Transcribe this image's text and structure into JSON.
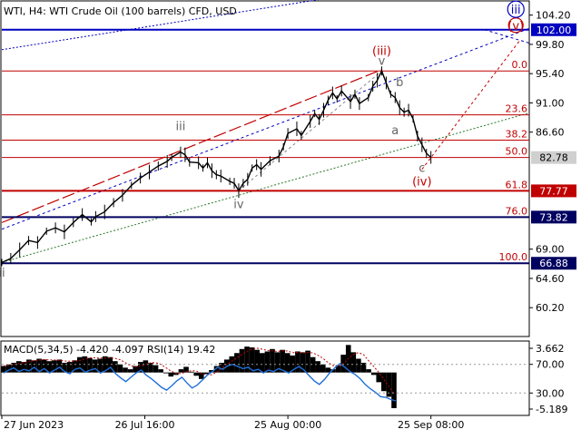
{
  "header": {
    "title": "WTI, H4:  WTI Crude Oil (100 barrels) CFD, USD",
    "indicator_label": "MACD(5,34,5) -4.420 -4.097 RSI(14) 19.42"
  },
  "colors": {
    "price_line": "#000000",
    "fib_line": "#c00000",
    "key_level": "#c00000",
    "level_blue": "#0000c0",
    "level_navy": "#000060",
    "wave_red": "#c00000",
    "wave_blue": "#0000c0",
    "wave_grey": "#666666",
    "macd_hist": "#000000",
    "rsi_line": "#1e6fd9",
    "signal_red": "#c00000"
  },
  "chart_data": {
    "type": "line",
    "instrument": "WTI, H4",
    "x_ticks": [
      "27 Jun 2023",
      "26 Jul 16:00",
      "25 Aug 00:00",
      "25 Sep 08:00"
    ],
    "price_axis": {
      "ylim": [
        56.0,
        106.2
      ],
      "ticks": [
        104.2,
        99.8,
        95.4,
        91.0,
        86.6,
        82.78,
        77.77,
        73.82,
        69.0,
        64.6,
        60.2,
        66.88,
        102.0
      ]
    },
    "tick_labels": [
      "104.20",
      "99.80",
      "95.40",
      "91.00",
      "86.60",
      "69.00",
      "64.60",
      "60.20"
    ],
    "price_series": [
      [
        0,
        67.0
      ],
      [
        2,
        67.6
      ],
      [
        4,
        68.9
      ],
      [
        6,
        70.3
      ],
      [
        8,
        70.0
      ],
      [
        10,
        71.7
      ],
      [
        12,
        72.2
      ],
      [
        14,
        71.6
      ],
      [
        16,
        73.0
      ],
      [
        18,
        74.2
      ],
      [
        20,
        73.1
      ],
      [
        21,
        73.9
      ],
      [
        23,
        74.6
      ],
      [
        25,
        76.0
      ],
      [
        27,
        77.1
      ],
      [
        29,
        78.6
      ],
      [
        31,
        79.7
      ],
      [
        33,
        80.6
      ],
      [
        35,
        81.5
      ],
      [
        37,
        82.2
      ],
      [
        38,
        82.8
      ],
      [
        40,
        83.6
      ],
      [
        41,
        83.2
      ],
      [
        42,
        82.1
      ],
      [
        44,
        82.0
      ],
      [
        45,
        81.2
      ],
      [
        46,
        82.0
      ],
      [
        47,
        80.8
      ],
      [
        48,
        80.2
      ],
      [
        49,
        80.0
      ],
      [
        51,
        79.2
      ],
      [
        52,
        78.9
      ],
      [
        53,
        77.8
      ],
      [
        54,
        78.9
      ],
      [
        55,
        79.5
      ],
      [
        56,
        81.2
      ],
      [
        57,
        81.7
      ],
      [
        58,
        81.0
      ],
      [
        60,
        82.3
      ],
      [
        62,
        83.0
      ],
      [
        63,
        84.4
      ],
      [
        64,
        86.4
      ],
      [
        66,
        87.1
      ],
      [
        67,
        86.1
      ],
      [
        69,
        88.2
      ],
      [
        70,
        89.4
      ],
      [
        71,
        88.5
      ],
      [
        72,
        89.9
      ],
      [
        73,
        91.4
      ],
      [
        74,
        92.5
      ],
      [
        75,
        91.6
      ],
      [
        76,
        92.8
      ],
      [
        78,
        91.2
      ],
      [
        79,
        92.3
      ],
      [
        80,
        90.9
      ],
      [
        82,
        91.8
      ],
      [
        83,
        93.5
      ],
      [
        84,
        94.4
      ],
      [
        85,
        95.8
      ],
      [
        86,
        94.0
      ],
      [
        87,
        92.3
      ],
      [
        88,
        91.8
      ],
      [
        89,
        90.3
      ],
      [
        90,
        89.6
      ],
      [
        91,
        89.9
      ],
      [
        92,
        88.6
      ],
      [
        93,
        86.0
      ],
      [
        94,
        84.7
      ],
      [
        95,
        83.4
      ],
      [
        96,
        82.8
      ]
    ],
    "horizontal_levels": [
      {
        "label": "0.0",
        "price": 95.8,
        "kind": "fib"
      },
      {
        "label": "23.6",
        "price": 89.2,
        "kind": "fib"
      },
      {
        "label": "38.2",
        "price": 85.4,
        "kind": "fib"
      },
      {
        "label": "50.0",
        "price": 82.78,
        "kind": "fib"
      },
      {
        "label": "61.8",
        "price": 77.77,
        "kind": "key"
      },
      {
        "label": "76.0",
        "price": 73.82,
        "kind": "navy"
      },
      {
        "label": "100.0",
        "price": 66.88,
        "kind": "navy"
      },
      {
        "label": "",
        "price": 102.0,
        "kind": "blue"
      }
    ],
    "axis_badges": [
      {
        "text": "102.00",
        "price": 102.0,
        "color": "#0000c0"
      },
      {
        "text": "82.78",
        "price": 82.78,
        "color": "#d0d0d0"
      },
      {
        "text": "77.77",
        "price": 77.77,
        "color": "#c00000"
      },
      {
        "text": "73.82",
        "price": 73.82,
        "color": "#000060"
      },
      {
        "text": "66.88",
        "price": 66.88,
        "color": "#000060"
      }
    ],
    "wave_labels": [
      {
        "text": "ii",
        "x": 0,
        "price": 64.9,
        "color": "#666666"
      },
      {
        "text": "iii",
        "x": 40,
        "price": 86.9,
        "color": "#666666"
      },
      {
        "text": "iv",
        "x": 53,
        "price": 75.2,
        "color": "#666666"
      },
      {
        "text": "(iii)",
        "x": 85,
        "price": 98.2,
        "color": "#c00000"
      },
      {
        "text": "v",
        "x": 85,
        "price": 96.7,
        "color": "#666666"
      },
      {
        "text": "b",
        "x": 89,
        "price": 93.5,
        "color": "#666666"
      },
      {
        "text": "a",
        "x": 88,
        "price": 86.3,
        "color": "#666666"
      },
      {
        "text": "c",
        "x": 94,
        "price": 80.6,
        "color": "#666666"
      },
      {
        "text": "(iv)",
        "x": 94,
        "price": 78.6,
        "color": "#c00000"
      },
      {
        "text": "(v)",
        "x": 115,
        "price": 102.0,
        "color": "#c00000"
      },
      {
        "text": "iii",
        "x": 115,
        "price": 104.4,
        "color": "#0000c0"
      }
    ],
    "forecast": [
      [
        94,
        81.0
      ],
      [
        116,
        100.5
      ]
    ],
    "indicator": {
      "name": "MACD(5,34,5) RSI(14)",
      "macd_value": -4.42,
      "signal_value": -4.097,
      "rsi_value": 19.42,
      "axis_labels": [
        "3.662",
        "70.00",
        "30.00",
        "-5.189"
      ],
      "ylim": [
        -5.189,
        3.662
      ],
      "histogram": [
        0.8,
        1.0,
        1.2,
        1.4,
        1.3,
        1.6,
        1.5,
        1.7,
        1.6,
        1.4,
        1.5,
        1.6,
        1.2,
        1.3,
        1.5,
        1.9,
        2.0,
        1.8,
        1.6,
        1.7,
        2.0,
        1.9,
        1.4,
        1.0,
        0.6,
        0.4,
        0.8,
        1.3,
        1.5,
        1.2,
        0.9,
        0.4,
        -0.1,
        -0.5,
        -0.3,
        0.4,
        0.7,
        0.1,
        -0.4,
        -0.8,
        -0.2,
        0.3,
        0.8,
        1.2,
        1.6,
        2.0,
        2.4,
        2.9,
        3.2,
        3.1,
        2.8,
        2.4,
        2.6,
        2.9,
        2.5,
        2.8,
        2.4,
        2.1,
        2.6,
        2.5,
        2.7,
        1.9,
        1.4,
        1.0,
        0.6,
        0.4,
        0.9,
        2.2,
        3.4,
        2.5,
        1.7,
        1.2,
        0.4,
        -0.3,
        -1.2,
        -2.3,
        -3.0,
        -4.4
      ],
      "rsi": [
        58,
        62,
        65,
        60,
        63,
        61,
        66,
        60,
        64,
        58,
        62,
        66,
        60,
        57,
        63,
        65,
        59,
        62,
        64,
        58,
        61,
        66,
        57,
        51,
        46,
        52,
        58,
        62,
        55,
        50,
        44,
        38,
        34,
        40,
        47,
        52,
        44,
        37,
        41,
        48,
        55,
        60,
        66,
        63,
        68,
        70,
        67,
        64,
        66,
        61,
        63,
        58,
        62,
        60,
        64,
        61,
        58,
        63,
        67,
        62,
        54,
        47,
        42,
        49,
        58,
        65,
        71,
        66,
        60,
        56,
        50,
        42,
        36,
        31,
        25,
        24,
        21,
        19
      ]
    }
  }
}
